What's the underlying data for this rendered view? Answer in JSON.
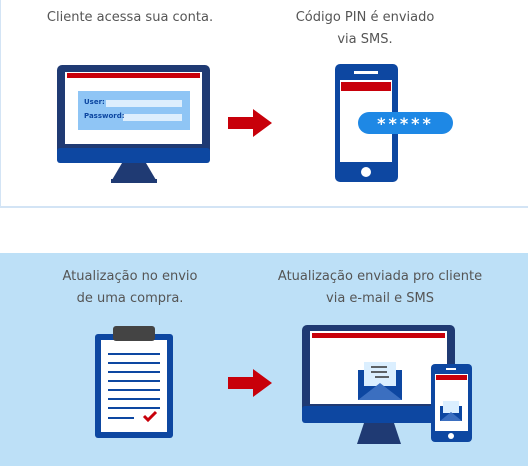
{
  "step1": {
    "caption": "Cliente acessa sua conta.",
    "user_label": "User:",
    "password_label": "Password:"
  },
  "step2": {
    "caption_line1": "Código PIN é enviado",
    "caption_line2": "via SMS.",
    "pin_mask": "*****"
  },
  "step3": {
    "caption_line1": "Atualização no envio",
    "caption_line2": "de uma compra."
  },
  "step4": {
    "caption_line1": "Atualização enviada pro cliente",
    "caption_line2": "via e-mail e SMS"
  },
  "colors": {
    "navy": "#1f3a73",
    "blue": "#0d47a1",
    "red": "#c8000a",
    "light_blue": "#bde0f7",
    "bubble": "#1e88e5"
  }
}
